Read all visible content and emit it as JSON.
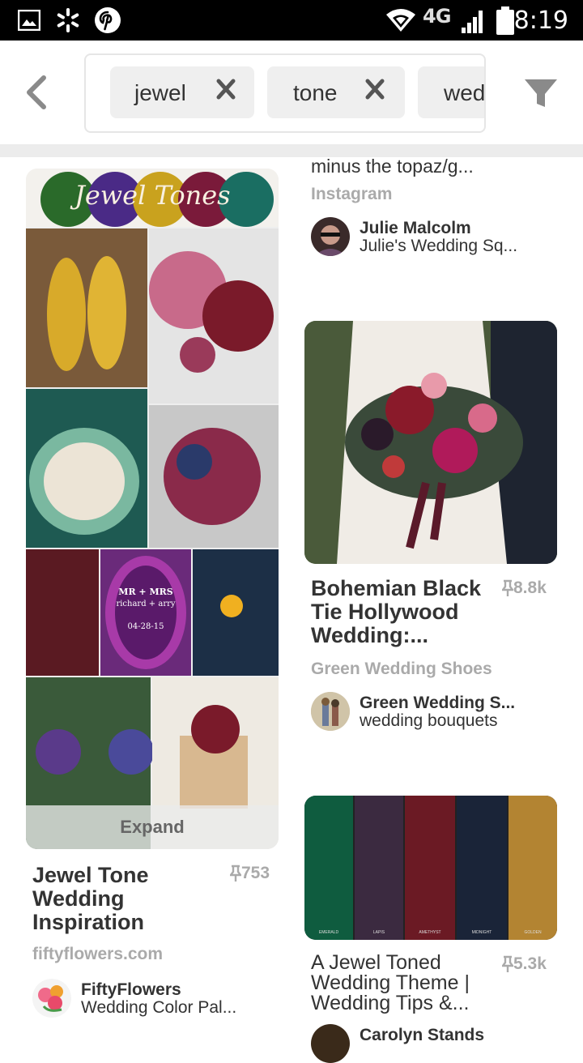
{
  "status_bar": {
    "time": "8:19",
    "network": "4G",
    "icons": [
      "image-icon",
      "walmart-spark-icon",
      "pinterest-icon",
      "wifi-icon",
      "signal-icon",
      "battery-icon"
    ]
  },
  "search": {
    "chips": [
      "jewel",
      "tone",
      "wed"
    ]
  },
  "left_pin": {
    "collage_logo_text": "Jewel Tones",
    "invite_names": "MR + MRS",
    "invite_sub": "richard + arry",
    "invite_date": "04-28-15",
    "expand_label": "Expand",
    "title": "Jewel Tone Wedding Inspiration",
    "title_lines": [
      "Jewel Tone",
      "Wedding",
      "Inspiration"
    ],
    "repins": "753",
    "source": "fiftyflowers.com",
    "user": "FiftyFlowers",
    "board": "Wedding Color Pal..."
  },
  "right_top_pin": {
    "desc_tail": "minus the topaz/g...",
    "source": "Instagram",
    "user": "Julie Malcolm",
    "board": "Julie's Wedding Sq..."
  },
  "right_mid_pin": {
    "title_lines": [
      "Bohemian Black",
      "Tie Hollywood",
      "Wedding:..."
    ],
    "repins": "8.8k",
    "source": "Green Wedding Shoes",
    "user": "Green Wedding S...",
    "board": "wedding bouquets"
  },
  "right_bottom_pin": {
    "swatches": [
      {
        "name": "EMERALD",
        "color": "#0f5c3f"
      },
      {
        "name": "LAPIS",
        "color": "#3b2a40"
      },
      {
        "name": "AMETHYST",
        "color": "#6b1a24"
      },
      {
        "name": "MIDNIGHT",
        "color": "#1a2438"
      },
      {
        "name": "GOLDEN",
        "color": "#b38432"
      }
    ],
    "title_lines": [
      "A Jewel Toned",
      "Wedding Theme |",
      "Wedding Tips &..."
    ],
    "repins": "5.3k",
    "user": "Carolyn Stands"
  },
  "colors": {
    "status_bg": "#000000",
    "chip_bg": "#efefef",
    "muted_text": "#aaaaaa"
  }
}
